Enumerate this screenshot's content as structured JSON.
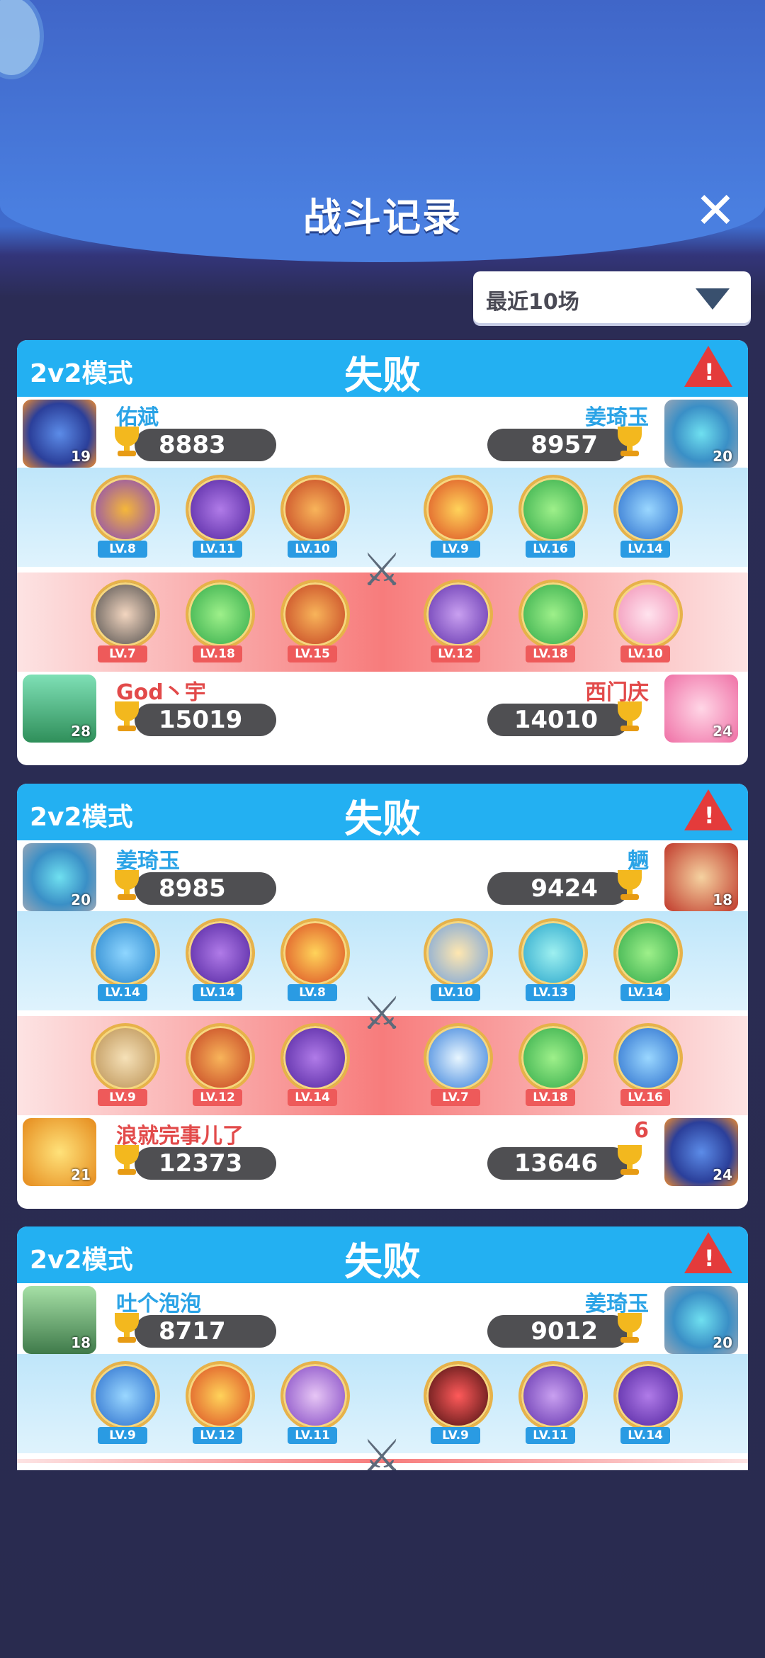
{
  "header": {
    "title": "战斗记录",
    "close_label": "✕"
  },
  "filter": {
    "label": "最近10场"
  },
  "colors": {
    "accent": "#23b0f2",
    "score_bg": "#4f4f52",
    "trophy": "#f3b81e",
    "warn": "#e43b3b"
  },
  "matches": [
    {
      "mode": "2v2模式",
      "result": "失败",
      "top_left": {
        "name": "佑斌",
        "score": "8883",
        "level": "19"
      },
      "top_right": {
        "name": "姜琦玉",
        "score": "8957",
        "level": "20"
      },
      "blue_levels": [
        "LV.8",
        "LV.11",
        "LV.10",
        "LV.9",
        "LV.16",
        "LV.14"
      ],
      "red_levels": [
        "LV.7",
        "LV.18",
        "LV.15",
        "LV.12",
        "LV.18",
        "LV.10"
      ],
      "bottom_left": {
        "name": "God丶宇",
        "score": "15019",
        "level": "28"
      },
      "bottom_right": {
        "name": "西门庆",
        "score": "14010",
        "level": "24"
      }
    },
    {
      "mode": "2v2模式",
      "result": "失败",
      "top_left": {
        "name": "姜琦玉",
        "score": "8985",
        "level": "20"
      },
      "top_right": {
        "name": "魉",
        "score": "9424",
        "level": "18"
      },
      "blue_levels": [
        "LV.14",
        "LV.14",
        "LV.8",
        "LV.10",
        "LV.13",
        "LV.14"
      ],
      "red_levels": [
        "LV.9",
        "LV.12",
        "LV.14",
        "LV.7",
        "LV.18",
        "LV.16"
      ],
      "bottom_left": {
        "name": "浪就完事儿了",
        "score": "12373",
        "level": "21"
      },
      "bottom_right": {
        "name": "6",
        "score": "13646",
        "level": "24"
      }
    },
    {
      "mode": "2v2模式",
      "result": "失败",
      "top_left": {
        "name": "吐个泡泡",
        "score": "8717",
        "level": "18"
      },
      "top_right": {
        "name": "姜琦玉",
        "score": "9012",
        "level": "20"
      },
      "blue_levels": [
        "LV.9",
        "LV.12",
        "LV.11",
        "LV.9",
        "LV.11",
        "LV.14"
      ]
    }
  ]
}
